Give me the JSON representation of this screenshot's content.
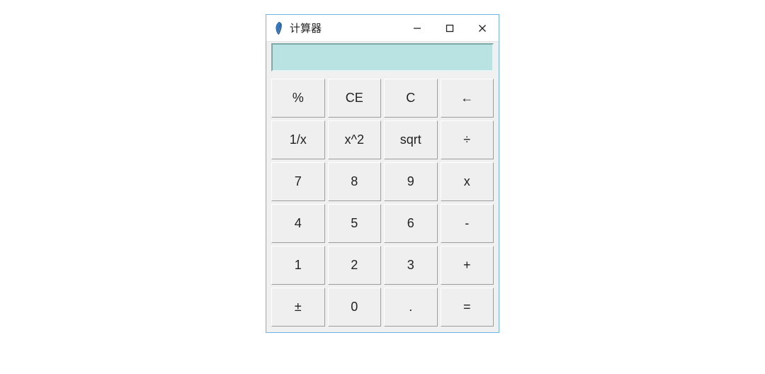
{
  "window": {
    "title": "计算器"
  },
  "display": {
    "value": ""
  },
  "keys": {
    "r0c0": "%",
    "r0c1": "CE",
    "r0c2": "C",
    "r0c3": "←",
    "r1c0": "1/x",
    "r1c1": "x^2",
    "r1c2": "sqrt",
    "r1c3": "÷",
    "r2c0": "7",
    "r2c1": "8",
    "r2c2": "9",
    "r2c3": "x",
    "r3c0": "4",
    "r3c1": "5",
    "r3c2": "6",
    "r3c3": "-",
    "r4c0": "1",
    "r4c1": "2",
    "r4c2": "3",
    "r4c3": "+",
    "r5c0": "±",
    "r5c1": "0",
    "r5c2": ".",
    "r5c3": "="
  }
}
